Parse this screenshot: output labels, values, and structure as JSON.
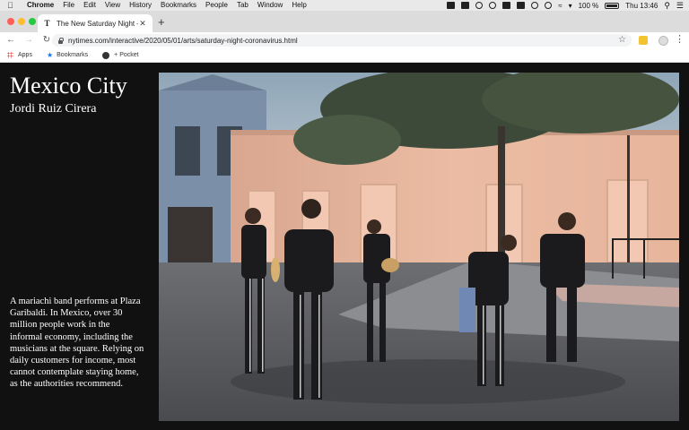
{
  "menubar": {
    "app": "Chrome",
    "items": [
      "File",
      "Edit",
      "View",
      "History",
      "Bookmarks",
      "People",
      "Tab",
      "Window",
      "Help"
    ],
    "battery": "100 %",
    "clock": "Thu 13:46"
  },
  "tab": {
    "title": "The New Saturday Night – The",
    "favicon": "T"
  },
  "address": {
    "url": "nytimes.com/interactive/2020/05/01/arts/saturday-night-coronavirus.html"
  },
  "bookmarks": {
    "apps": "Apps",
    "bookmarks": "Bookmarks",
    "pocket": "+ Pocket"
  },
  "article": {
    "headline": "Mexico City",
    "byline": "Jordi Ruiz Cirera",
    "caption": "A mariachi band performs at Plaza Garibaldi. In Mexico, over 30 million people work in the informal economy, including the musicians at the square. Relying on daily customers for income, most cannot contemplate staying home, as the authorities recommend."
  },
  "colors": {
    "page_bg": "#111111",
    "tab_strip": "#dcdcdc",
    "wall": "#e8b89e"
  }
}
